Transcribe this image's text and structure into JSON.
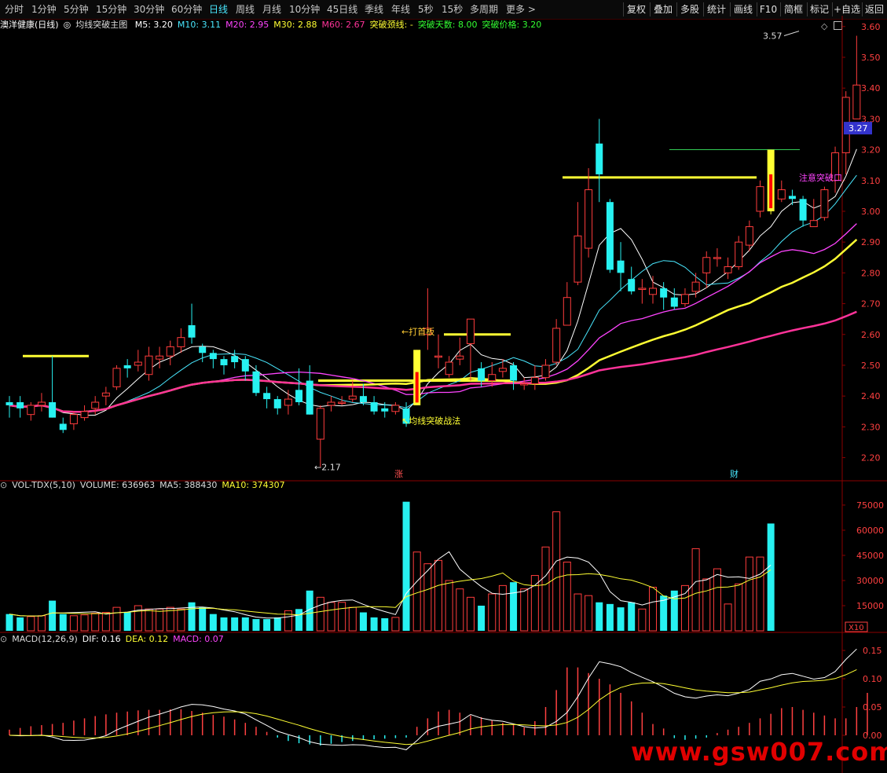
{
  "toolbar": {
    "left": [
      "分时",
      "1分钟",
      "5分钟",
      "15分钟",
      "30分钟",
      "60分钟",
      "日线",
      "周线",
      "月线",
      "10分钟",
      "45日线",
      "季线",
      "年线",
      "5秒",
      "15秒",
      "多周期",
      "更多 >"
    ],
    "active": "日线",
    "right": [
      "复权",
      "叠加",
      "多股",
      "统计",
      "画线",
      "F10",
      "简框",
      "标记",
      "+自选",
      "返回"
    ]
  },
  "main": {
    "stock_title": "澳洋健康(日线)",
    "indicator_name": "均线突破主图",
    "ma": [
      {
        "label": "M5: 3.20",
        "color": "#ffffff"
      },
      {
        "label": "M10: 3.11",
        "color": "#49e8ff"
      },
      {
        "label": "M20: 2.95",
        "color": "#ff44ff"
      },
      {
        "label": "M30: 2.88",
        "color": "#ffff33"
      },
      {
        "label": "M60: 2.67",
        "color": "#ff3399"
      },
      {
        "label": "突破颈线: -",
        "color": "#ffff33"
      },
      {
        "label": "突破天数: 8.00",
        "color": "#33ff33"
      },
      {
        "label": "突破价格: 3.20",
        "color": "#33ff33"
      }
    ],
    "current_price": "3.27",
    "annotations": {
      "high": "3.57",
      "low": "2.17",
      "hit_board": "←打首板",
      "strategy": "↖均线突破战法",
      "breakout": "注意突破口"
    },
    "markers": [
      "涨",
      "财"
    ],
    "y_ticks": [
      "3.60",
      "3.50",
      "3.40",
      "3.30",
      "3.20",
      "3.10",
      "3.00",
      "2.90",
      "2.80",
      "2.70",
      "2.60",
      "2.50",
      "2.40",
      "2.30",
      "2.20"
    ]
  },
  "volume": {
    "title": "VOL-TDX(5,10)",
    "volume": "VOLUME: 636963",
    "ma5": "MA5: 388430",
    "ma10": "MA10: 374307",
    "y_ticks": [
      "75000",
      "60000",
      "45000",
      "30000",
      "15000"
    ],
    "unit": "X10"
  },
  "macd": {
    "title": "MACD(12,26,9)",
    "dif": "DIF: 0.16",
    "dea": "DEA: 0.12",
    "macd": "MACD: 0.07",
    "y_ticks": [
      "0.15",
      "0.10",
      "0.05",
      "0.00"
    ]
  },
  "watermark": "www.gsw007.com",
  "colors": {
    "up": "#ff3c3c",
    "down": "#27f1f1",
    "axis": "#8b0000",
    "ma5": "#ffffff",
    "ma10": "#49e8ff",
    "ma20": "#ff44ff",
    "ma30": "#ffff33",
    "ma60": "#ff3399"
  },
  "chart_data": {
    "type": "candlestick",
    "candles": [
      [
        2.38,
        2.37,
        2.4,
        2.33
      ],
      [
        2.38,
        2.36,
        2.4,
        2.33
      ],
      [
        2.34,
        2.37,
        2.38,
        2.32
      ],
      [
        2.37,
        2.38,
        2.41,
        2.35
      ],
      [
        2.38,
        2.33,
        2.53,
        2.33
      ],
      [
        2.31,
        2.29,
        2.33,
        2.28
      ],
      [
        2.31,
        2.34,
        2.35,
        2.29
      ],
      [
        2.33,
        2.35,
        2.37,
        2.32
      ],
      [
        2.36,
        2.38,
        2.4,
        2.34
      ],
      [
        2.4,
        2.41,
        2.43,
        2.37
      ],
      [
        2.43,
        2.49,
        2.5,
        2.42
      ],
      [
        2.5,
        2.49,
        2.52,
        2.46
      ],
      [
        2.5,
        2.51,
        2.55,
        2.48
      ],
      [
        2.47,
        2.53,
        2.56,
        2.45
      ],
      [
        2.52,
        2.53,
        2.56,
        2.49
      ],
      [
        2.53,
        2.56,
        2.58,
        2.5
      ],
      [
        2.56,
        2.59,
        2.62,
        2.54
      ],
      [
        2.63,
        2.59,
        2.7,
        2.57
      ],
      [
        2.56,
        2.54,
        2.57,
        2.51
      ],
      [
        2.54,
        2.52,
        2.55,
        2.49
      ],
      [
        2.52,
        2.5,
        2.53,
        2.47
      ],
      [
        2.53,
        2.51,
        2.55,
        2.49
      ],
      [
        2.52,
        2.48,
        2.53,
        2.45
      ],
      [
        2.48,
        2.41,
        2.5,
        2.4
      ],
      [
        2.41,
        2.39,
        2.43,
        2.36
      ],
      [
        2.39,
        2.36,
        2.4,
        2.34
      ],
      [
        2.37,
        2.39,
        2.42,
        2.34
      ],
      [
        2.42,
        2.38,
        2.49,
        2.37
      ],
      [
        2.45,
        2.34,
        2.5,
        2.34
      ],
      [
        2.26,
        2.36,
        2.37,
        2.17
      ],
      [
        2.37,
        2.38,
        2.4,
        2.35
      ],
      [
        2.38,
        2.38,
        2.4,
        2.37
      ],
      [
        2.39,
        2.4,
        2.45,
        2.38
      ],
      [
        2.4,
        2.38,
        2.44,
        2.37
      ],
      [
        2.38,
        2.35,
        2.4,
        2.34
      ],
      [
        2.36,
        2.35,
        2.38,
        2.33
      ],
      [
        2.35,
        2.37,
        2.38,
        2.34
      ],
      [
        2.36,
        2.31,
        2.38,
        2.3
      ],
      [
        2.37,
        2.55,
        2.55,
        2.37
      ],
      [
        2.6,
        2.62,
        2.75,
        2.55
      ],
      [
        2.53,
        2.53,
        2.6,
        2.49
      ],
      [
        2.47,
        2.51,
        2.53,
        2.46
      ],
      [
        2.52,
        2.53,
        2.59,
        2.5
      ],
      [
        2.57,
        2.65,
        2.65,
        2.45
      ],
      [
        2.49,
        2.45,
        2.51,
        2.43
      ],
      [
        2.45,
        2.47,
        2.51,
        2.43
      ],
      [
        2.48,
        2.49,
        2.52,
        2.46
      ],
      [
        2.5,
        2.45,
        2.51,
        2.42
      ],
      [
        2.44,
        2.44,
        2.46,
        2.42
      ],
      [
        2.44,
        2.46,
        2.5,
        2.42
      ],
      [
        2.46,
        2.5,
        2.52,
        2.45
      ],
      [
        2.51,
        2.62,
        2.65,
        2.5
      ],
      [
        2.63,
        2.72,
        2.77,
        2.63
      ],
      [
        2.77,
        2.92,
        3.03,
        2.76
      ],
      [
        2.88,
        3.07,
        3.14,
        2.85
      ],
      [
        3.22,
        3.12,
        3.3,
        3.03
      ],
      [
        3.03,
        2.81,
        3.04,
        2.8
      ],
      [
        2.84,
        2.8,
        2.9,
        2.74
      ],
      [
        2.78,
        2.74,
        2.82,
        2.73
      ],
      [
        2.75,
        2.75,
        2.78,
        2.7
      ],
      [
        2.73,
        2.75,
        2.79,
        2.7
      ],
      [
        2.75,
        2.72,
        2.77,
        2.68
      ],
      [
        2.72,
        2.69,
        2.75,
        2.68
      ],
      [
        2.7,
        2.73,
        2.75,
        2.69
      ],
      [
        2.74,
        2.77,
        2.8,
        2.72
      ],
      [
        2.8,
        2.85,
        2.87,
        2.75
      ],
      [
        2.85,
        2.85,
        2.88,
        2.82
      ],
      [
        2.8,
        2.82,
        2.85,
        2.78
      ],
      [
        2.82,
        2.9,
        2.92,
        2.81
      ],
      [
        2.89,
        2.95,
        2.97,
        2.87
      ],
      [
        3.0,
        3.08,
        3.1,
        2.98
      ],
      [
        3.2,
        3.0,
        3.2,
        2.99
      ],
      [
        3.04,
        3.07,
        3.1,
        3.03
      ],
      [
        3.05,
        3.04,
        3.07,
        3.02
      ],
      [
        3.04,
        2.97,
        3.05,
        2.95
      ],
      [
        2.95,
        2.97,
        3.04,
        2.95
      ],
      [
        2.98,
        3.07,
        3.08,
        2.97
      ],
      [
        3.1,
        3.19,
        3.21,
        3.06
      ],
      [
        3.19,
        3.37,
        3.39,
        3.12
      ],
      [
        3.3,
        3.41,
        3.57,
        3.3
      ]
    ],
    "volume_values": [
      10000,
      8000,
      8500,
      9000,
      18000,
      10000,
      9000,
      9500,
      10500,
      11000,
      14000,
      11000,
      15000,
      13000,
      13000,
      14000,
      13000,
      17000,
      14000,
      10000,
      8000,
      8000,
      8000,
      7000,
      7000,
      8000,
      12000,
      13000,
      24000,
      20000,
      17000,
      17000,
      14000,
      11000,
      8000,
      7500,
      8000,
      77000,
      47000,
      40000,
      42000,
      30000,
      25000,
      20000,
      15000,
      22000,
      27000,
      29000,
      25000,
      33000,
      50000,
      71000,
      41000,
      22000,
      21000,
      17000,
      16000,
      14000,
      17000,
      13000,
      26000,
      21000,
      24000,
      27000,
      49000,
      31000,
      37000,
      16000,
      28000,
      44000,
      44000,
      64000
    ],
    "macd_bars": [
      0.01,
      0.013,
      0.016,
      0.018,
      0.02,
      0.022,
      0.026,
      0.03,
      0.034,
      0.037,
      0.04,
      0.042,
      0.044,
      0.045,
      0.045,
      0.046,
      0.046,
      0.043,
      0.04,
      0.036,
      0.033,
      0.028,
      0.022,
      0.015,
      0.006,
      -0.004,
      -0.01,
      -0.014,
      -0.016,
      -0.018,
      -0.015,
      -0.012,
      -0.01,
      -0.008,
      -0.007,
      -0.006,
      -0.005,
      -0.004,
      0.015,
      0.03,
      0.042,
      0.045,
      0.04,
      0.035,
      0.032,
      0.027,
      0.022,
      0.018,
      0.014,
      0.025,
      0.05,
      0.08,
      0.12,
      0.12,
      0.11,
      0.1,
      0.09,
      0.075,
      0.06,
      0.04,
      0.02,
      0.012,
      -0.005,
      -0.008,
      -0.006,
      -0.004,
      0.004,
      0.01,
      0.015,
      0.022,
      0.03,
      0.038,
      0.048,
      0.05,
      0.045,
      0.04,
      0.035,
      0.03,
      0.03,
      0.05,
      0.075
    ],
    "y_range": [
      2.13,
      3.63
    ]
  }
}
